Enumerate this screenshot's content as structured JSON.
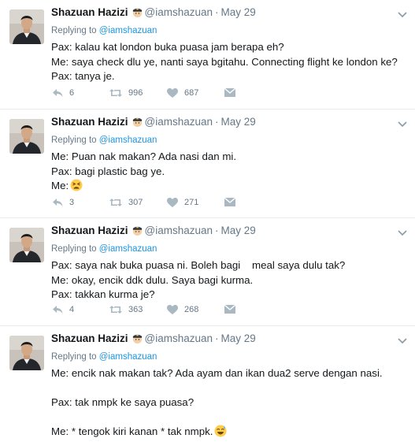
{
  "tweets": [
    {
      "name": "Shazuan Hazizi",
      "handle": "@iamshazuan",
      "separator": "·",
      "time": "May 29",
      "replying_prefix": "Replying to",
      "replying_handle": "@iamshazuan",
      "lines": [
        "Pax: kalau kat london buka puasa jam berapa eh?",
        "Me: saya check dlu ye, nanti saya bgitahu. Connecting flight ke london ke?",
        "Pax: tanya je."
      ],
      "replies": "6",
      "retweets": "996",
      "likes": "687"
    },
    {
      "name": "Shazuan Hazizi",
      "handle": "@iamshazuan",
      "separator": "·",
      "time": "May 29",
      "replying_prefix": "Replying to",
      "replying_handle": "@iamshazuan",
      "lines": [
        "Me: Puan nak makan? Ada nasi dan mi.",
        "Pax: bagi plastic bag ye.",
        "Me:"
      ],
      "replies": "3",
      "retweets": "307",
      "likes": "271"
    },
    {
      "name": "Shazuan Hazizi",
      "handle": "@iamshazuan",
      "separator": "·",
      "time": "May 29",
      "replying_prefix": "Replying to",
      "replying_handle": "@iamshazuan",
      "lines": [
        "Pax: saya nak buka puasa ni. Boleh bagi    meal saya dulu tak?",
        "Me: okay, encik ddk dulu. Saya bagi kurma.",
        "Pax: takkan kurma je?"
      ],
      "replies": "4",
      "retweets": "363",
      "likes": "268"
    },
    {
      "name": "Shazuan Hazizi",
      "handle": "@iamshazuan",
      "separator": "·",
      "time": "May 29",
      "replying_prefix": "Replying to",
      "replying_handle": "@iamshazuan",
      "lines": [
        "Me: encik nak makan tak? Ada ayam dan ikan dua2 serve dengan nasi.",
        "",
        "Pax: tak nmpk ke saya puasa?",
        "",
        "Me: * tengok kiri kanan * tak nmpk."
      ]
    }
  ],
  "icons": {
    "reply": "reply-icon",
    "retweet": "retweet-icon",
    "like": "heart-icon",
    "dm": "envelope-icon",
    "caret": "chevron-down-icon",
    "badge": "pilot-emoji-icon",
    "emoji_2": "tired-face-emoji-icon",
    "emoji_4": "sweat-smile-emoji-icon"
  },
  "colors": {
    "name": "#14171a",
    "meta": "#657786",
    "link": "#1b95e0",
    "divider": "#e6ecf0"
  }
}
